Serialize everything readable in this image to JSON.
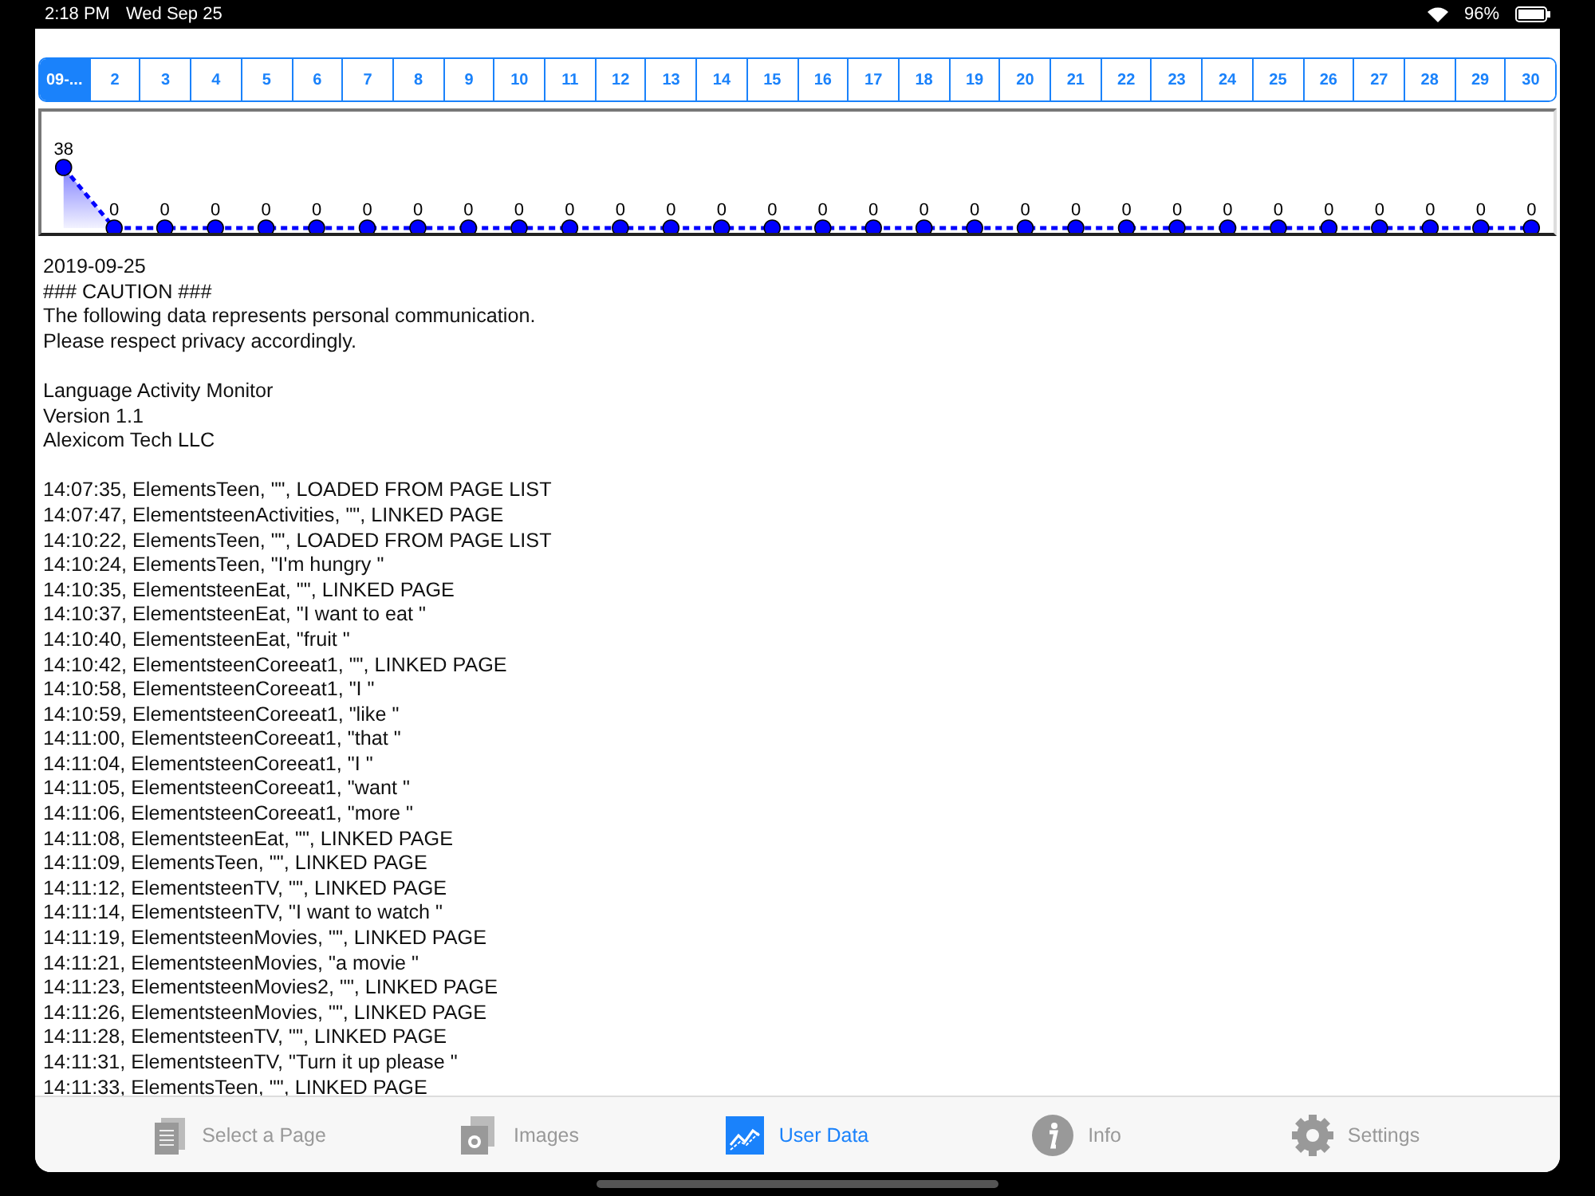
{
  "status_bar": {
    "time": "2:18 PM",
    "date": "Wed Sep 25",
    "battery": "96%"
  },
  "date_segments": [
    {
      "label": "09-...",
      "selected": true
    },
    {
      "label": "2",
      "selected": false
    },
    {
      "label": "3",
      "selected": false
    },
    {
      "label": "4",
      "selected": false
    },
    {
      "label": "5",
      "selected": false
    },
    {
      "label": "6",
      "selected": false
    },
    {
      "label": "7",
      "selected": false
    },
    {
      "label": "8",
      "selected": false
    },
    {
      "label": "9",
      "selected": false
    },
    {
      "label": "10",
      "selected": false
    },
    {
      "label": "11",
      "selected": false
    },
    {
      "label": "12",
      "selected": false
    },
    {
      "label": "13",
      "selected": false
    },
    {
      "label": "14",
      "selected": false
    },
    {
      "label": "15",
      "selected": false
    },
    {
      "label": "16",
      "selected": false
    },
    {
      "label": "17",
      "selected": false
    },
    {
      "label": "18",
      "selected": false
    },
    {
      "label": "19",
      "selected": false
    },
    {
      "label": "20",
      "selected": false
    },
    {
      "label": "21",
      "selected": false
    },
    {
      "label": "22",
      "selected": false
    },
    {
      "label": "23",
      "selected": false
    },
    {
      "label": "24",
      "selected": false
    },
    {
      "label": "25",
      "selected": false
    },
    {
      "label": "26",
      "selected": false
    },
    {
      "label": "27",
      "selected": false
    },
    {
      "label": "28",
      "selected": false
    },
    {
      "label": "29",
      "selected": false
    },
    {
      "label": "30",
      "selected": false
    }
  ],
  "chart_data": {
    "type": "area",
    "data_labels": true,
    "series": [
      {
        "color": "#0000ff",
        "values": [
          38,
          0,
          0,
          0,
          0,
          0,
          0,
          0,
          0,
          0,
          0,
          0,
          0,
          0,
          0,
          0,
          0,
          0,
          0,
          0,
          0,
          0,
          0,
          0,
          0,
          0,
          0,
          0,
          0,
          0
        ]
      }
    ]
  },
  "log_blocks": [
    [
      "2019-09-25",
      "### CAUTION ###",
      "The following data represents personal communication.",
      "Please respect privacy accordingly."
    ],
    [
      "Language Activity Monitor",
      "Version 1.1",
      "Alexicom Tech LLC"
    ],
    [
      "14:07:35, ElementsTeen, \"\", LOADED FROM PAGE LIST",
      "14:07:47, ElementsteenActivities, \"\", LINKED PAGE",
      "14:10:22, ElementsTeen, \"\", LOADED FROM PAGE LIST",
      "14:10:24, ElementsTeen, \"I'm hungry \"",
      "14:10:35, ElementsteenEat, \"\", LINKED PAGE",
      "14:10:37, ElementsteenEat, \"I want to eat \"",
      "14:10:40, ElementsteenEat, \"fruit \"",
      "14:10:42, ElementsteenCoreeat1, \"\", LINKED PAGE",
      "14:10:58, ElementsteenCoreeat1, \"I \"",
      "14:10:59, ElementsteenCoreeat1, \"like \"",
      "14:11:00, ElementsteenCoreeat1, \"that \"",
      "14:11:04, ElementsteenCoreeat1, \"I \"",
      "14:11:05, ElementsteenCoreeat1, \"want \"",
      "14:11:06, ElementsteenCoreeat1, \"more \"",
      "14:11:08, ElementsteenEat, \"\", LINKED PAGE",
      "14:11:09, ElementsTeen, \"\", LINKED PAGE",
      "14:11:12, ElementsteenTV, \"\", LINKED PAGE",
      "14:11:14, ElementsteenTV, \"I want to watch \"",
      "14:11:19, ElementsteenMovies, \"\", LINKED PAGE",
      "14:11:21, ElementsteenMovies, \"a movie \"",
      "14:11:23, ElementsteenMovies2, \"\", LINKED PAGE",
      "14:11:26, ElementsteenMovies, \"\", LINKED PAGE",
      "14:11:28, ElementsteenTV, \"\", LINKED PAGE",
      "14:11:31, ElementsteenTV, \"Turn it up please \"",
      "14:11:33, ElementsTeen, \"\", LINKED PAGE"
    ]
  ],
  "tab_bar": [
    {
      "kind": "pages",
      "label": "Select a Page",
      "selected": false
    },
    {
      "kind": "images",
      "label": "Images",
      "selected": false
    },
    {
      "kind": "data",
      "label": "User Data",
      "selected": true
    },
    {
      "kind": "info",
      "label": "Info",
      "selected": false
    },
    {
      "kind": "settings",
      "label": "Settings",
      "selected": false
    }
  ]
}
